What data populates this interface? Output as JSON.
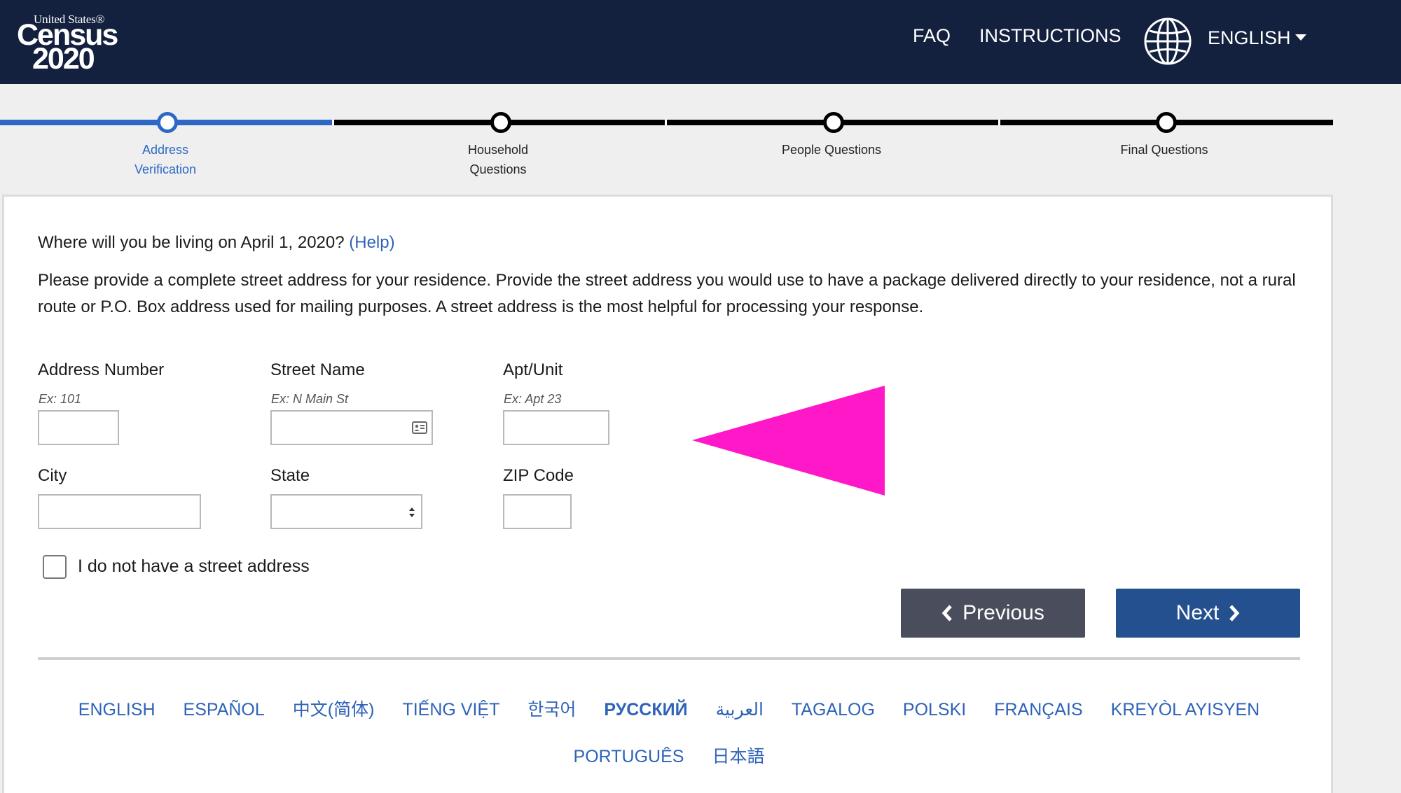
{
  "header": {
    "logo": {
      "top": "United States®",
      "census": "Census",
      "year": "2020"
    },
    "nav": {
      "faq": "FAQ",
      "instructions": "INSTRUCTIONS"
    },
    "language": "ENGLISH"
  },
  "progress": {
    "steps": [
      {
        "label_line1": "Address",
        "label_line2": "Verification"
      },
      {
        "label_line1": "Household",
        "label_line2": "Questions"
      },
      {
        "label_line1": "People Questions"
      },
      {
        "label_line1": "Final Questions"
      }
    ],
    "active_index": 0
  },
  "form": {
    "question": "Where will you be living on April 1, 2020?",
    "help": "(Help)",
    "instructions": "Please provide a complete street address for your residence. Provide the street address you would use to have a package delivered directly to your residence, not a rural route or P.O. Box address used for mailing purposes. A street address is the most helpful for processing your response.",
    "fields": {
      "address_number": {
        "label": "Address Number",
        "hint": "Ex: 101",
        "value": ""
      },
      "street_name": {
        "label": "Street Name",
        "hint": "Ex: N Main St",
        "value": ""
      },
      "apt_unit": {
        "label": "Apt/Unit",
        "hint": "Ex: Apt 23",
        "value": ""
      },
      "city": {
        "label": "City",
        "value": ""
      },
      "state": {
        "label": "State",
        "value": ""
      },
      "zip": {
        "label": "ZIP Code",
        "value": ""
      }
    },
    "no_street_address": "I do not have a street address"
  },
  "buttons": {
    "previous": "Previous",
    "next": "Next"
  },
  "languages": [
    "ENGLISH",
    "ESPAÑOL",
    "中文(简体)",
    "TIẾNG VIỆT",
    "한국어",
    "РУССКИЙ",
    "العربية",
    "TAGALOG",
    "POLSKI",
    "FRANÇAIS",
    "KREYÒL AYISYEN",
    "PORTUGUÊS",
    "日本語"
  ],
  "colors": {
    "header_bg": "#13213f",
    "accent": "#2c68c4",
    "link": "#2f63b7",
    "next_button": "#24508f",
    "prev_button": "#4a4e5c",
    "annotation_arrow": "#ff18c8"
  }
}
